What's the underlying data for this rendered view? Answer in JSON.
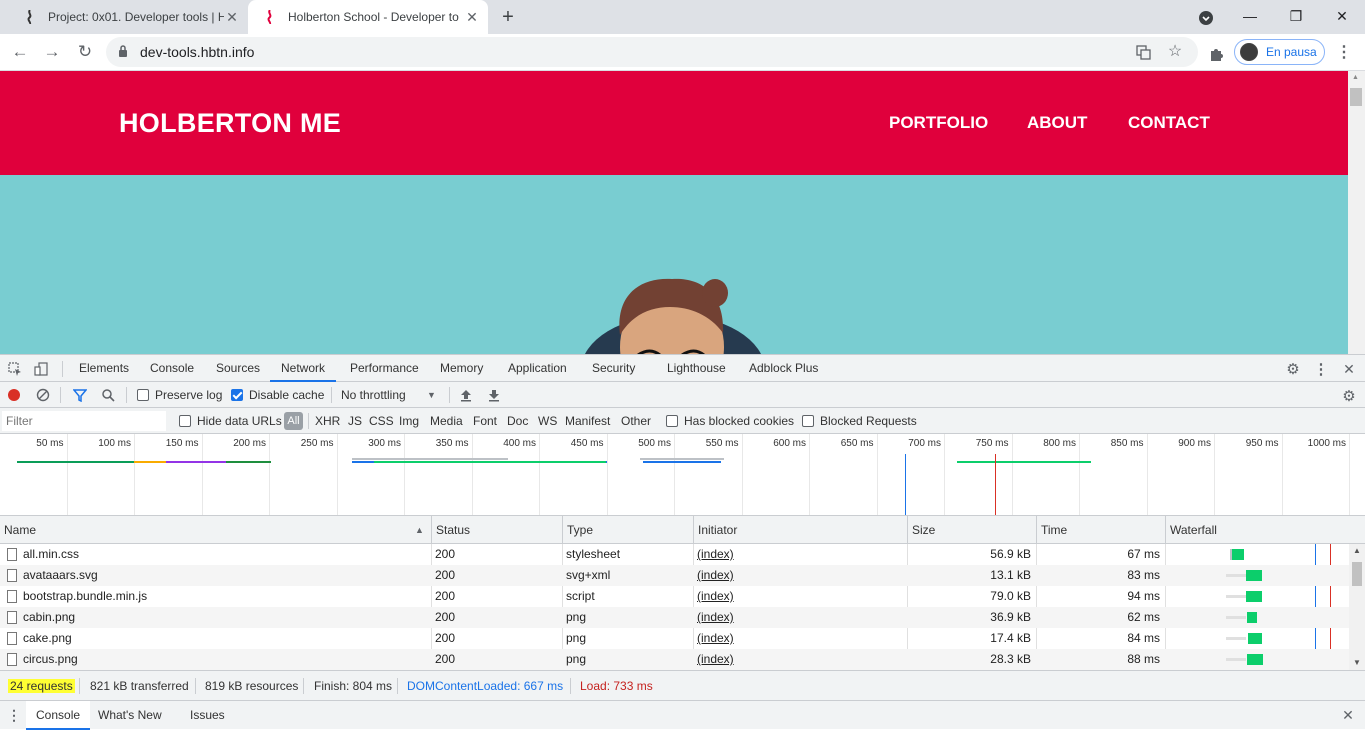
{
  "browser": {
    "tabs": [
      {
        "title": "Project: 0x01. Developer tools | H"
      },
      {
        "title": "Holberton School - Developer to"
      }
    ],
    "url": "dev-tools.hbtn.info",
    "profile_label": "En pausa"
  },
  "page": {
    "brand": "HOLBERTON ME",
    "nav": [
      "PORTFOLIO",
      "ABOUT",
      "CONTACT"
    ],
    "header_color": "#e0003c",
    "hero_color": "#79cdd1"
  },
  "devtools": {
    "tabs": [
      "Elements",
      "Console",
      "Sources",
      "Network",
      "Performance",
      "Memory",
      "Application",
      "Security",
      "Lighthouse",
      "Adblock Plus"
    ],
    "active_tab": "Network",
    "toolbar": {
      "preserve_log": "Preserve log",
      "disable_cache": "Disable cache",
      "throttling": "No throttling"
    },
    "filter": {
      "placeholder": "Filter",
      "hide_data_urls": "Hide data URLs",
      "types": [
        "All",
        "XHR",
        "JS",
        "CSS",
        "Img",
        "Media",
        "Font",
        "Doc",
        "WS",
        "Manifest",
        "Other"
      ],
      "has_blocked_cookies": "Has blocked cookies",
      "blocked_requests": "Blocked Requests"
    },
    "timeline_ticks": [
      "50 ms",
      "100 ms",
      "150 ms",
      "200 ms",
      "250 ms",
      "300 ms",
      "350 ms",
      "400 ms",
      "450 ms",
      "500 ms",
      "550 ms",
      "600 ms",
      "650 ms",
      "700 ms",
      "750 ms",
      "800 ms",
      "850 ms",
      "900 ms",
      "950 ms",
      "1000 ms"
    ],
    "columns": [
      "Name",
      "Status",
      "Type",
      "Initiator",
      "Size",
      "Time",
      "Waterfall"
    ],
    "requests": [
      {
        "name": "all.min.css",
        "status": "200",
        "type": "stylesheet",
        "initiator": "(index)",
        "size": "56.9 kB",
        "time": "67 ms"
      },
      {
        "name": "avataaars.svg",
        "status": "200",
        "type": "svg+xml",
        "initiator": "(index)",
        "size": "13.1 kB",
        "time": "83 ms"
      },
      {
        "name": "bootstrap.bundle.min.js",
        "status": "200",
        "type": "script",
        "initiator": "(index)",
        "size": "79.0 kB",
        "time": "94 ms"
      },
      {
        "name": "cabin.png",
        "status": "200",
        "type": "png",
        "initiator": "(index)",
        "size": "36.9 kB",
        "time": "62 ms"
      },
      {
        "name": "cake.png",
        "status": "200",
        "type": "png",
        "initiator": "(index)",
        "size": "17.4 kB",
        "time": "84 ms"
      },
      {
        "name": "circus.png",
        "status": "200",
        "type": "png",
        "initiator": "(index)",
        "size": "28.3 kB",
        "time": "88 ms"
      }
    ],
    "summary": {
      "requests": "24 requests",
      "transferred": "821 kB transferred",
      "resources": "819 kB resources",
      "finish": "Finish: 804 ms",
      "dom_content_loaded": "DOMContentLoaded: 667 ms",
      "load": "Load: 733 ms"
    },
    "drawer_tabs": [
      "Console",
      "What's New",
      "Issues"
    ]
  }
}
